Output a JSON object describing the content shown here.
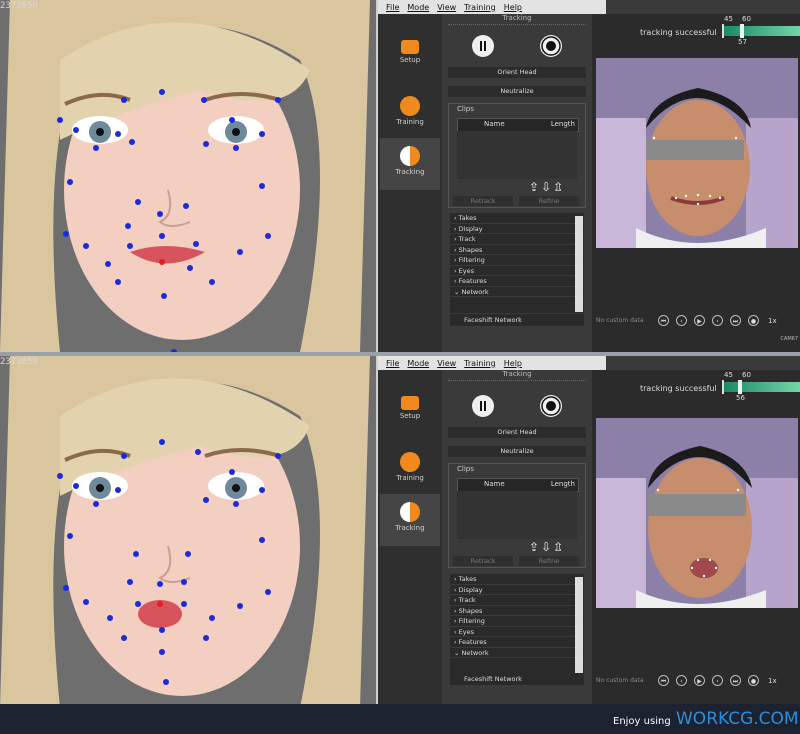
{
  "viewport": {
    "frame_label": "2373050"
  },
  "app": {
    "menu": [
      "File",
      "Mode",
      "View",
      "Training",
      "Help"
    ],
    "sidebar": [
      {
        "label": "Setup",
        "icon": "camera-icon"
      },
      {
        "label": "Training",
        "icon": "smiley-icon"
      },
      {
        "label": "Tracking",
        "icon": "face-profile-icon"
      }
    ],
    "tracking_header": "Tracking",
    "orient_head": "Orient Head",
    "neutralize": "Neutralize",
    "clips": {
      "title": "Clips",
      "col_name": "Name",
      "col_length": "Length"
    },
    "retrack": "Retrack",
    "refine": "Refine",
    "accordion": [
      "Takes",
      "Display",
      "Track",
      "Shapes",
      "Filtering",
      "Eyes",
      "Features",
      "Network"
    ],
    "network_select": "Faceshift Network",
    "status": "tracking successful",
    "meter_labels": {
      "left": "45",
      "right": "60"
    },
    "play_placeholder": "No custom data",
    "speed": "1x",
    "cam_label": "CAM67"
  },
  "panels": [
    {
      "meter_value": "57"
    },
    {
      "meter_value": "56"
    }
  ],
  "footer": {
    "enjoy": "Enjoy using",
    "brand": "WORKCG.COM"
  },
  "colors": {
    "accent_orange": "#f08a1e",
    "meter_green": "#3fbf8a",
    "brand_blue": "#2a8fdc",
    "marker_blue": "#1a2bd9"
  }
}
